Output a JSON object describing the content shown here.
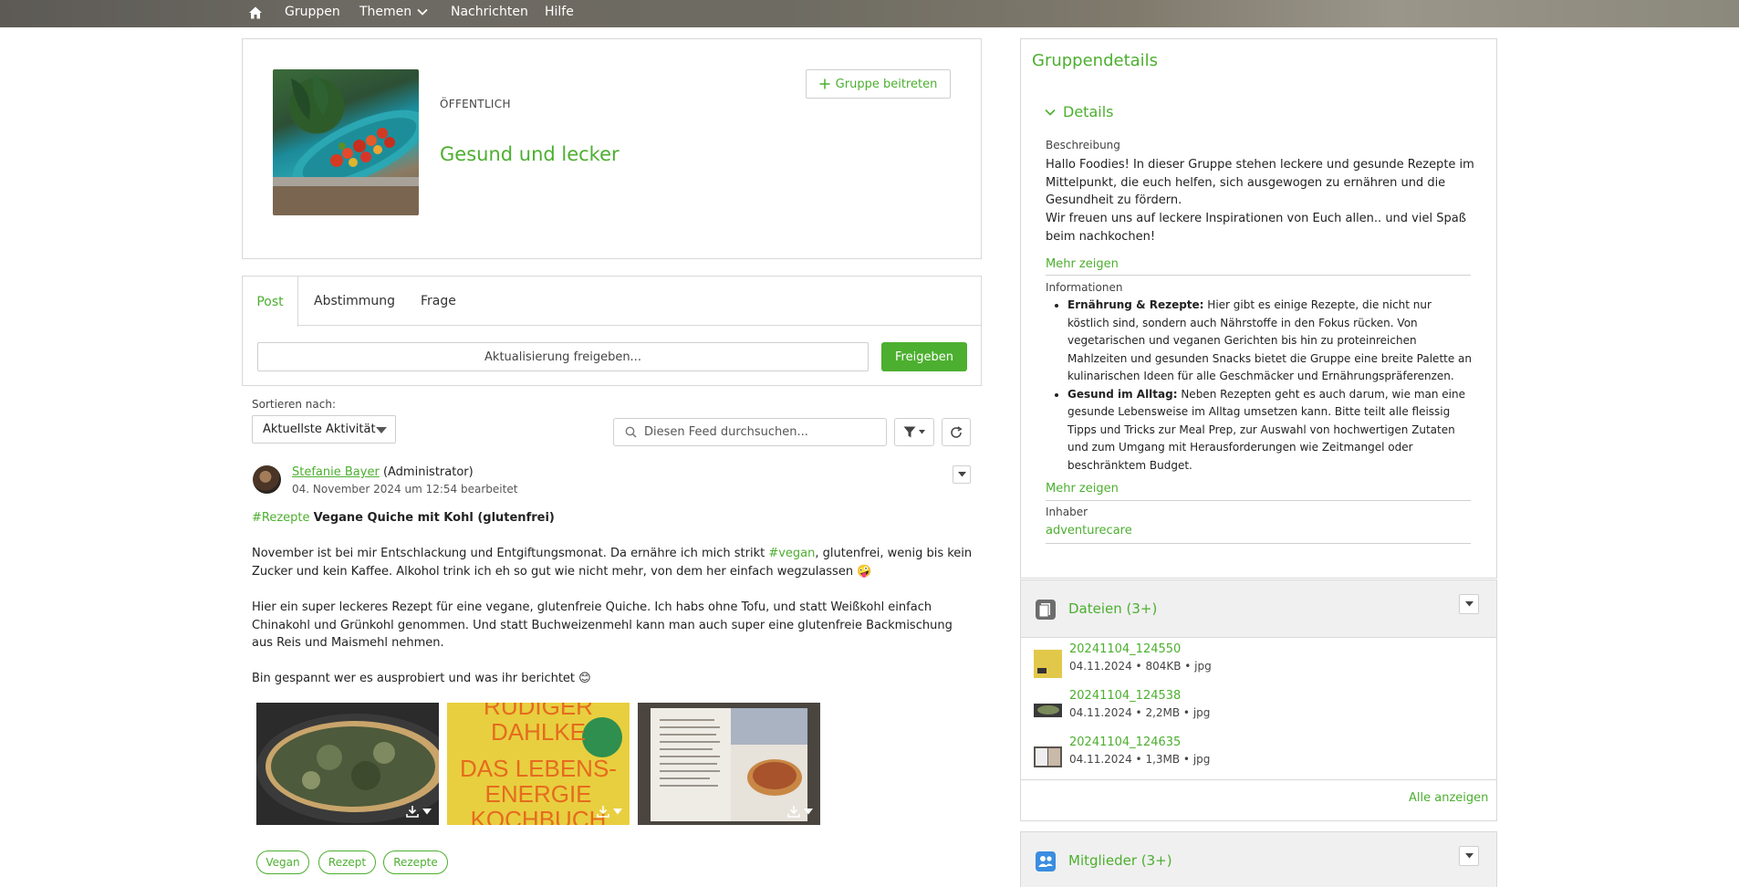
{
  "nav": {
    "items": [
      "Gruppen",
      "Themen",
      "Nachrichten",
      "Hilfe"
    ]
  },
  "group": {
    "visibility": "ÖFFENTLICH",
    "title": "Gesund und lecker",
    "join_label": "Gruppe beitreten"
  },
  "composer": {
    "tabs": [
      "Post",
      "Abstimmung",
      "Frage"
    ],
    "placeholder": "Aktualisierung freigeben...",
    "share_label": "Freigeben"
  },
  "feed": {
    "sort_label": "Sortieren nach:",
    "sort_value": "Aktuellste Aktivität",
    "search_placeholder": "Diesen Feed durchsuchen..."
  },
  "post": {
    "author": "Stefanie Bayer",
    "role": "(Administrator)",
    "timestamp": "04. November 2024 um 12:54 bearbeitet",
    "hashtag": "#Rezepte",
    "title": "Vegane Quiche mit Kohl (glutenfrei)",
    "p1_a": "November ist bei mir Entschlackung und Entgiftungsmonat. Da ernähre ich mich strikt ",
    "p1_tag": "#vegan",
    "p1_b": ", glutenfrei, wenig bis kein Zucker und kein Kaffee. Alkohol trink ich eh so gut wie nicht mehr, von dem her einfach wegzulassen 🤪",
    "p2": "Hier ein super leckeres Rezept für eine vegane, glutenfreie Quiche. Ich habs ohne Tofu, und statt Weißkohl einfach Chinakohl und Grünkohl genommen. Und statt Buchweizenmehl kann man auch super eine glutenfreie Backmischung aus Reis und Maismehl nehmen.",
    "p3": "Bin gespannt wer es ausprobiert und was ihr berichtet 😊",
    "book_line1": "RÜDIGER",
    "book_line2": "DAHLKE",
    "book_line3": "DAS LEBENS-",
    "book_line4": "ENERGIE",
    "book_line5": "KOCHBUCH",
    "topics": [
      "Vegan",
      "Rezept",
      "Rezepte"
    ]
  },
  "details": {
    "heading": "Gruppendetails",
    "section": "Details",
    "desc_label": "Beschreibung",
    "desc_p1": "Hallo Foodies! In dieser Gruppe stehen leckere und gesunde Rezepte im Mittelpunkt, die euch helfen, sich ausgewogen zu ernähren und die Gesundheit zu fördern.",
    "desc_p2": "Wir freuen uns auf leckere Inspirationen von Euch allen.. und viel Spaß beim nachkochen!",
    "more_label": "Mehr zeigen",
    "info_label": "Informationen",
    "info_items": [
      {
        "bold": "Ernährung & Rezepte:",
        "text": " Hier gibt es einige Rezepte, die nicht nur köstlich sind, sondern auch Nährstoffe in den Fokus rücken. Von vegetarischen und veganen Gerichten bis hin zu proteinreichen Mahlzeiten und gesunden Snacks bietet die Gruppe eine breite Palette an kulinarischen Ideen für alle Geschmäcker und Ernährungspräferenzen."
      },
      {
        "bold": "Gesund im Alltag:",
        "text": " Neben Rezepten geht es auch darum, wie man eine gesunde Lebensweise im Alltag umsetzen kann. Bitte teilt alle fleissig Tipps und Tricks zur Meal Prep, zur Auswahl von hochwertigen Zutaten und zum Umgang mit Herausforderungen wie Zeitmangel oder beschränktem Budget."
      }
    ],
    "more_label2": "Mehr zeigen",
    "owner_label": "Inhaber",
    "owner": "adventurecare"
  },
  "files": {
    "title": "Dateien (3+)",
    "items": [
      {
        "name": "20241104_124550",
        "date": "04.11.2024",
        "size": "804KB",
        "type": "jpg"
      },
      {
        "name": "20241104_124538",
        "date": "04.11.2024",
        "size": "2,2MB",
        "type": "jpg"
      },
      {
        "name": "20241104_124635",
        "date": "04.11.2024",
        "size": "1,3MB",
        "type": "jpg"
      }
    ],
    "all_label": "Alle anzeigen"
  },
  "members": {
    "title": "Mitglieder (3+)"
  },
  "colors": {
    "accent": "#4caf2f",
    "border": "#d8d8d8"
  }
}
